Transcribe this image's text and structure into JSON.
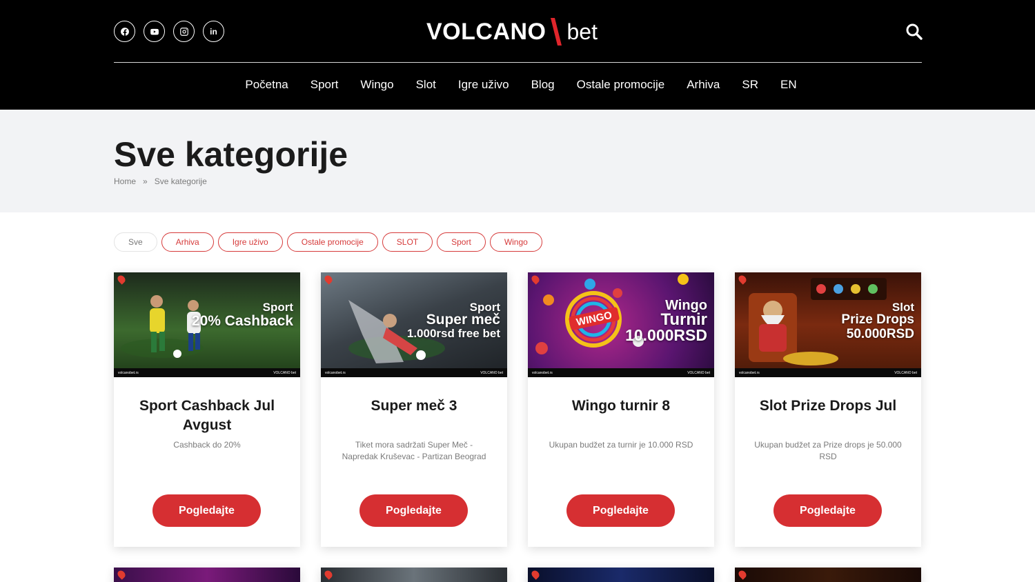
{
  "brand": {
    "logo_main": "VOLCANO",
    "logo_sub": "bet",
    "accent": "#d62f32"
  },
  "social": [
    {
      "name": "facebook-icon"
    },
    {
      "name": "youtube-icon"
    },
    {
      "name": "instagram-icon"
    },
    {
      "name": "linkedin-icon",
      "label": "in"
    }
  ],
  "nav": [
    "Početna",
    "Sport",
    "Wingo",
    "Slot",
    "Igre uživo",
    "Blog",
    "Ostale promocije",
    "Arhiva",
    "SR",
    "EN"
  ],
  "page": {
    "title": "Sve kategorije",
    "breadcrumb": {
      "home": "Home",
      "separator": "»",
      "current": "Sve kategorije"
    }
  },
  "filters": [
    "Sve",
    "Arhiva",
    "Igre uživo",
    "Ostale promocije",
    "SLOT",
    "Sport",
    "Wingo"
  ],
  "cards": [
    {
      "title": "Sport Cashback Jul Avgust",
      "description": "Cashback do 20%",
      "button": "Pogledajte",
      "banner": {
        "line1": "Sport",
        "line2": "20% Cashback",
        "line3": "",
        "site": "volcanobet.rs",
        "brand": "VOLCANO bet",
        "bg": "#2e4a2c"
      }
    },
    {
      "title": "Super meč 3",
      "description": "Tiket mora sadržati Super Meč - Napredak Kruševac - Partizan Beograd",
      "button": "Pogledajte",
      "banner": {
        "line1": "Sport",
        "line2": "Super meč",
        "line3": "1.000rsd free bet",
        "site": "volcanobet.rs",
        "brand": "VOLCANO bet",
        "bg": "#3a3f45"
      }
    },
    {
      "title": "Wingo turnir 8",
      "description": "Ukupan budžet za turnir je 10.000 RSD",
      "button": "Pogledajte",
      "banner": {
        "line1": "Wingo",
        "line2": "Turnir",
        "line3": "10.000RSD",
        "site": "volcanobet.rs",
        "brand": "VOLCANO bet",
        "bg": "#6a1a7a"
      }
    },
    {
      "title": "Slot Prize Drops Jul",
      "description": "Ukupan budžet za Prize drops je 50.000 RSD",
      "button": "Pogledajte",
      "banner": {
        "line1": "Slot",
        "line2": "Prize Drops",
        "line3": "50.000RSD",
        "site": "volcanobet.rs",
        "brand": "VOLCANO bet",
        "bg": "#6a2a12"
      }
    }
  ]
}
